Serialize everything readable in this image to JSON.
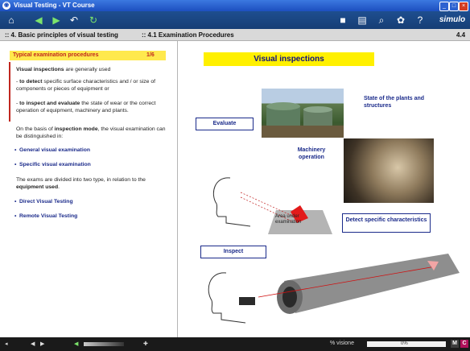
{
  "window": {
    "title": "Visual Testing - VT Course",
    "app_icon": "app-logo-icon",
    "controls": [
      "_",
      "□",
      "×"
    ]
  },
  "toolbar": {
    "left_icons": [
      "home-icon",
      "back-icon",
      "forward-icon",
      "undo-icon",
      "refresh-icon"
    ],
    "right_icons": [
      "print-icon",
      "save-icon",
      "zoom-icon",
      "settings-icon",
      "help-icon"
    ],
    "brand": "simulo"
  },
  "breadcrumb": {
    "chapter": ":: 4. Basic principles of visual testing",
    "section": ":: 4.1 Examination Procedures",
    "page": "4.4"
  },
  "left_panel": {
    "header_title": "Typical examination procedures",
    "header_page": "1/6",
    "p1_bold": "Visual inspections",
    "p1_rest": " are generally used",
    "p2_prefix": "- ",
    "p2_bold": "to detect",
    "p2_rest": " specific surface characteristics and / or size of components or pieces of equipment or",
    "p3_prefix": "- ",
    "p3_bold": "to inspect and evaluate",
    "p3_rest": " the state of wear or the correct operation of equipment, machinery and plants.",
    "p4_a": "On the basis of ",
    "p4_bold": "inspection mode",
    "p4_b": ", the visual examination can be distinguished in:",
    "bullet1": "General visual examination",
    "bullet2": "Specific visual examination",
    "p5_a": "The exams are divided into two type, in relation to the ",
    "p5_bold": "equipment used",
    "p5_b": ".",
    "bullet3": "Direct Visual Testing",
    "bullet4": "Remote Visual Testing"
  },
  "right_panel": {
    "title": "Visual inspections",
    "label_plants": "State of the plants and structures",
    "box_evaluate": "Evaluate",
    "label_machinery": "Machinery operation",
    "label_area": "Area under examination",
    "box_detect": "Detect specific characteristics",
    "box_inspect": "Inspect"
  },
  "status_bar": {
    "progress_label": "% visione",
    "progress_value": "0%",
    "progress_fraction": 0.0,
    "btn_m": "M",
    "btn_c": "C"
  }
}
